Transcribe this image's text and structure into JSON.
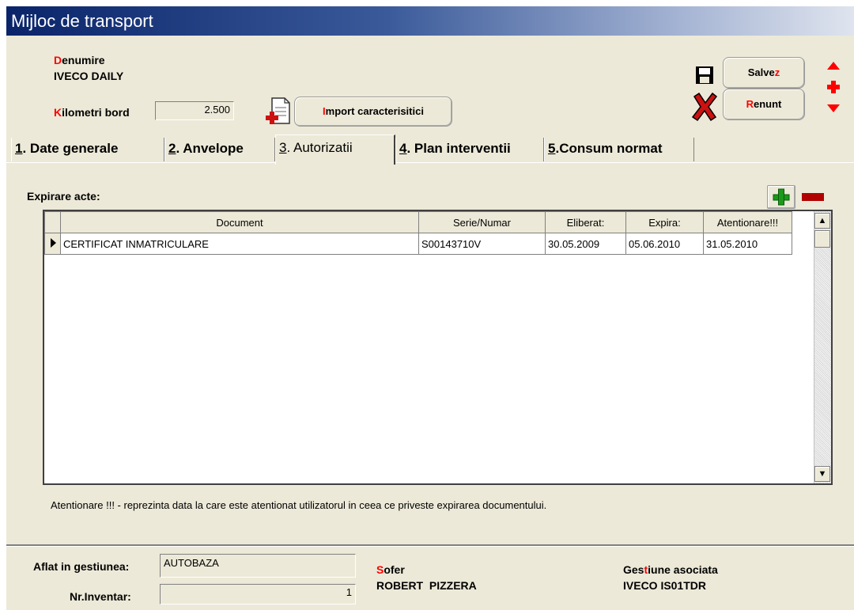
{
  "window": {
    "title": "Mijloc de transport"
  },
  "header": {
    "denumire_label_first": "D",
    "denumire_label_rest": "enumire",
    "denumire_value": "IVECO DAILY",
    "km_label_first": "K",
    "km_label_rest": "ilometri bord",
    "km_value": "2.500",
    "import_first": "I",
    "import_rest": "mport caracterisitici"
  },
  "actions": {
    "salvez_a": "Salve",
    "salvez_b": "z",
    "renunt_a": "R",
    "renunt_b": "enunt"
  },
  "tabs": [
    {
      "num": "1",
      "label": ". Date generale"
    },
    {
      "num": "2",
      "label": ". Anvelope"
    },
    {
      "num": "3",
      "label": ". Autorizatii"
    },
    {
      "num": "4",
      "label": ". Plan interventii"
    },
    {
      "num": "5",
      "label": ".Consum normat"
    }
  ],
  "active_tab": "3",
  "acts": {
    "label": "Expirare acte:",
    "columns": [
      "Document",
      "Serie/Numar",
      "Eliberat:",
      "Expira:",
      "Atentionare!!!"
    ],
    "rows": [
      [
        "CERTIFICAT INMATRICULARE",
        "S00143710V",
        "30.05.2009",
        "05.06.2010",
        "31.05.2010"
      ]
    ],
    "note": "Atentionare !!! - reprezinta data la care este atentionat utilizatorul in ceea ce priveste expirarea documentului."
  },
  "footer": {
    "gestiune_label": "Aflat in gestiunea:",
    "gestiune_value": "AUTOBAZA",
    "inventar_label": "Nr.Inventar:",
    "inventar_value": "1",
    "sofer_label_first": "S",
    "sofer_label_rest": "ofer",
    "sofer_value": "ROBERT  PIZZERA",
    "gest_assoc_a": "Ges",
    "gest_assoc_b": "t",
    "gest_assoc_c": "iune asociata",
    "gest_assoc_value": "IVECO IS01TDR"
  },
  "colors": {
    "accent_red": "#ff0000",
    "title_blue": "#0a246a",
    "plus_green": "#1a9a1a"
  }
}
